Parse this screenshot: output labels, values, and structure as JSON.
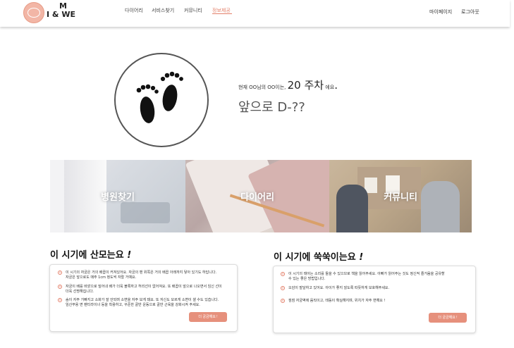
{
  "header": {
    "brand_top": "M",
    "brand_bottom": "I & WE",
    "nav": [
      {
        "label": "다이어리",
        "active": false
      },
      {
        "label": "서비스찾기",
        "active": false
      },
      {
        "label": "커뮤니티",
        "active": false
      },
      {
        "label": "정보제공",
        "active": true
      }
    ],
    "mypage_label": "마이페이지",
    "logout_label": "로그아웃"
  },
  "hero": {
    "week_prefix": "현재 OO님의 OO이는,",
    "week_value": "20 주차",
    "week_suffix": "에요",
    "period": ".",
    "dday": "앞으로 D-??"
  },
  "banners": [
    {
      "label": "병원찾기"
    },
    {
      "label": "다이어리"
    },
    {
      "label": "커뮤니티"
    }
  ],
  "mother": {
    "title": "이 시기에 산모는요",
    "exclaim": "!",
    "items": [
      {
        "line1": "이 시기의 자궁은 거의 배꼽이 커져있어요. 자궁의 맨 위쪽은 거의 배꼽 아래까지 닿아 있기도 하답니다.",
        "line2": "자궁은 앞으로도 매주 1cm 정도씩 자랄 거예요."
      },
      {
        "line1": "자궁이 배를 바깥으로 밀어내 배가 더욱 볼록하고 허리선이 없어져요. 또 배꼽이 앞으로 나오면서 임신 선이",
        "line2": "더욱 선명해집니다."
      },
      {
        "line1": "숨이 자주 가빠지고 소화가 잘 안되며 소변을 자주 보게 돼요. 또 자신도 모르게 소변이 샐 수도 있습니다.",
        "line2": "임산부용 면 팬티라이너 등을 착용하고, 꾸준한 골반 운동으로 골반 근육을 강화시켜 주세요."
      }
    ],
    "button_label": "더 궁금해요 !"
  },
  "baby": {
    "title": "이 시기에 쑥쑥이는요",
    "exclaim": "!",
    "items": [
      {
        "line1": "이 시기의 태아는 소리를 들을 수 있으므로 책을 읽어주세요. 아빠가 읽어주는 것도 정신적 즐거움을 공유할",
        "line2": "수 있는 좋은 방법입니다."
      },
      {
        "line1": "오감이 발달하고 있어요. 아이가 좋지 않도록 따뜻하게 보호해주세요.",
        "line2": ""
      },
      {
        "line1": "점점 자궁벽에 움직이고, 태동이 확실해지며, 위치가 자주 변해요 !",
        "line2": ""
      }
    ],
    "button_label": "더 궁금해요 !"
  },
  "colors": {
    "accent": "#e3806a",
    "button": "#e6907c",
    "logo": "#f2b6a6"
  },
  "icons": [
    "footprints-icon",
    "logo-icon",
    "check-circle-icon"
  ]
}
